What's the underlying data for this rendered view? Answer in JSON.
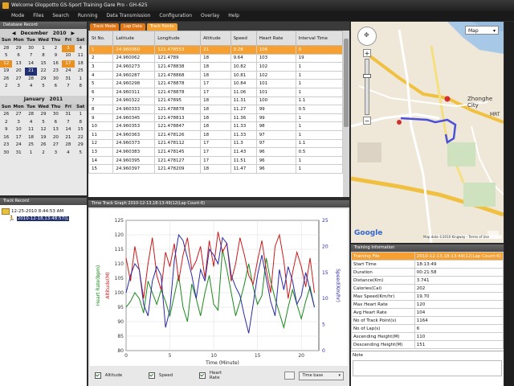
{
  "window": {
    "title": "Welcome Gloppotto GS-Sport Training Gare Pro - GH-625"
  },
  "menu": [
    "Mode",
    "Files",
    "Search",
    "Running",
    "Data Transmission",
    "Configuration",
    "Overlay",
    "Help"
  ],
  "database": {
    "title": "Database Record",
    "cal1": {
      "month": "December",
      "year": "2010",
      "dow": [
        "Sun",
        "Mon",
        "Tue",
        "Wed",
        "Thu",
        "Fri",
        "Sat"
      ],
      "days": [
        "28",
        "29",
        "30",
        "1",
        "2",
        "3",
        "4",
        "5",
        "6",
        "7",
        "8",
        "9",
        "10",
        "11",
        "12",
        "13",
        "14",
        "15",
        "16",
        "17",
        "18",
        "19",
        "20",
        "21",
        "22",
        "23",
        "24",
        "25",
        "26",
        "27",
        "28",
        "29",
        "30",
        "31",
        "1",
        "2",
        "3",
        "4",
        "5",
        "6",
        "7",
        "8"
      ]
    },
    "cal2": {
      "month": "January",
      "year": "2011",
      "dow": [
        "Sun",
        "Mon",
        "Tue",
        "Wed",
        "Thu",
        "Fri",
        "Sat"
      ],
      "days": [
        "26",
        "27",
        "28",
        "29",
        "30",
        "31",
        "1",
        "2",
        "3",
        "4",
        "5",
        "6",
        "7",
        "8",
        "9",
        "10",
        "11",
        "12",
        "13",
        "14",
        "15",
        "16",
        "17",
        "18",
        "19",
        "20",
        "21",
        "22",
        "23",
        "24",
        "25",
        "26",
        "27",
        "28",
        "29",
        "30",
        "31",
        "1",
        "2",
        "3",
        "4",
        "5"
      ]
    }
  },
  "track_record": {
    "title": "Track Record",
    "items": [
      "12-25-2010 8:44:53 AM",
      "2010-12-18,13:48:57(L"
    ]
  },
  "tabs": [
    "Track Mode",
    "Lap Data",
    "Track Points"
  ],
  "table": {
    "columns": [
      "St No.",
      "Latitude",
      "Longitude",
      "Altitude",
      "Speed",
      "Heart Rate",
      "Interval Time"
    ],
    "rows": [
      [
        "1",
        "24.960060",
        "121.478553",
        "21",
        "0.28",
        "106",
        "0"
      ],
      [
        "2",
        "24.960062",
        "121.4789",
        "18",
        "9.64",
        "103",
        "19"
      ],
      [
        "3",
        "24.960273",
        "121.478838",
        "18",
        "10.82",
        "102",
        "1"
      ],
      [
        "4",
        "24.960287",
        "121.478868",
        "18",
        "10.81",
        "102",
        "1"
      ],
      [
        "5",
        "24.960298",
        "121.478878",
        "17",
        "10.84",
        "101",
        "1"
      ],
      [
        "6",
        "24.960311",
        "121.478878",
        "17",
        "11.06",
        "101",
        "1"
      ],
      [
        "7",
        "24.960322",
        "121.47895",
        "18",
        "11.31",
        "100",
        "1.1"
      ],
      [
        "8",
        "24.960333",
        "121.478878",
        "18",
        "11.27",
        "99",
        "0.5"
      ],
      [
        "9",
        "24.960345",
        "121.478813",
        "18",
        "11.36",
        "99",
        "1"
      ],
      [
        "10",
        "24.960353",
        "121.478847",
        "18",
        "11.33",
        "98",
        "1"
      ],
      [
        "11",
        "24.960363",
        "121.478126",
        "18",
        "11.33",
        "97",
        "1"
      ],
      [
        "12",
        "24.960373",
        "121.478112",
        "17",
        "11.3",
        "97",
        "1.1"
      ],
      [
        "13",
        "24.960383",
        "121.478145",
        "17",
        "11.43",
        "96",
        "0.5"
      ],
      [
        "14",
        "24.960395",
        "121.478127",
        "17",
        "11.51",
        "96",
        "1"
      ],
      [
        "15",
        "24.960397",
        "121.478209",
        "18",
        "11.47",
        "96",
        "1"
      ]
    ]
  },
  "chart_panel": {
    "title": "Time Track Graph 2010-12-13,18:13:49(12(Lap Count:6)"
  },
  "chart_data": {
    "type": "line",
    "title": "",
    "xlabel": "Time (Minute)",
    "ylabel": "Heart Rate(bpm)",
    "y2label": "Speed(Km/hr)",
    "y3label": "Altitude(M)",
    "xlim": [
      0,
      22
    ],
    "ylim": [
      80,
      125
    ],
    "x_ticks": [
      "0",
      "5",
      "10",
      "15",
      "20"
    ],
    "y_ticks": [
      "80",
      "85",
      "90",
      "95",
      "100",
      "105",
      "110",
      "115",
      "120",
      "125"
    ],
    "y2_ticks": [
      "0",
      "5",
      "10",
      "15",
      "20",
      "25"
    ],
    "series": [
      {
        "name": "Altitude",
        "color": "#1a8a1a",
        "x": [
          0,
          0.5,
          1,
          1.5,
          2,
          2.5,
          3,
          3.5,
          4,
          4.5,
          5,
          5.5,
          6,
          6.5,
          7,
          7.5,
          8,
          8.5,
          9,
          9.5,
          10,
          10.5,
          11,
          11.5,
          12,
          12.5,
          13,
          13.5,
          14,
          14.5,
          15,
          15.5,
          16,
          16.5,
          17,
          17.5,
          18,
          18.5,
          19,
          19.5,
          20,
          20.5,
          21,
          21.5
        ],
        "y": [
          95,
          97,
          100,
          98,
          93,
          104,
          100,
          96,
          101,
          97,
          92,
          99,
          106,
          95,
          90,
          103,
          98,
          92,
          100,
          106,
          96,
          94,
          115,
          108,
          100,
          92,
          97,
          103,
          110,
          102,
          96,
          99,
          112,
          104,
          98,
          93,
          88,
          95,
          101,
          96,
          91,
          97,
          102,
          95
        ]
      },
      {
        "name": "Speed",
        "color": "#cc1a1a",
        "x": [
          0,
          0.5,
          1,
          1.5,
          2,
          2.5,
          3,
          3.5,
          4,
          4.5,
          5,
          5.5,
          6,
          6.5,
          7,
          7.5,
          8,
          8.5,
          9,
          9.5,
          10,
          10.5,
          11,
          11.5,
          12,
          12.5,
          13,
          13.5,
          14,
          14.5,
          15,
          15.5,
          16,
          16.5,
          17,
          17.5,
          18,
          18.5,
          19,
          19.5,
          20,
          20.5,
          21,
          21.5
        ],
        "y": [
          112,
          104,
          116,
          108,
          98,
          110,
          119,
          106,
          101,
          114,
          109,
          117,
          104,
          113,
          119,
          108,
          111,
          116,
          105,
          118,
          109,
          121,
          114,
          117,
          104,
          110,
          119,
          113,
          106,
          103,
          111,
          118,
          108,
          100,
          116,
          120,
          111,
          98,
          107,
          114,
          109,
          102,
          112,
          100
        ]
      },
      {
        "name": "Heart Rate",
        "color": "#2a2aa8",
        "x": [
          0,
          0.5,
          1,
          1.5,
          2,
          2.5,
          3,
          3.5,
          4,
          4.5,
          5,
          5.5,
          6,
          6.5,
          7,
          7.5,
          8,
          8.5,
          9,
          9.5,
          10,
          10.5,
          11,
          11.5,
          12,
          12.5,
          13,
          13.5,
          14,
          14.5,
          15,
          15.5,
          16,
          16.5,
          17,
          17.5,
          18,
          18.5,
          19,
          19.5,
          20,
          20.5,
          21,
          21.5
        ],
        "y": [
          100,
          106,
          110,
          108,
          96,
          92,
          104,
          109,
          106,
          88,
          94,
          111,
          120,
          118,
          112,
          106,
          98,
          108,
          104,
          115,
          113,
          110,
          119,
          117,
          106,
          102,
          99,
          92,
          86,
          96,
          106,
          113,
          105,
          97,
          92,
          108,
          101,
          109,
          104,
          96,
          99,
          107,
          101,
          95
        ]
      }
    ]
  },
  "chart_legend": {
    "altitude": "Altitude",
    "speed": "Speed",
    "heart_rate": "Heart Rate",
    "time_base": "Time base"
  },
  "map": {
    "maptype": "Map",
    "place1": "Zhonghe City",
    "place2": "MRT",
    "footer": "Map data ©2010 Kingway - Terms of Use",
    "google": "Google"
  },
  "training_info": {
    "title": "Training Information",
    "rows": [
      [
        "Training File",
        "2010-12-13,18:13:49(12(Lap Count:6)"
      ],
      [
        "Start Time",
        "18:13:49"
      ],
      [
        "Duration",
        "00:21:58"
      ],
      [
        "Distance(Km)",
        "3.741"
      ],
      [
        "Calories(Cal)",
        "202"
      ],
      [
        "Max Speed(Km/hr)",
        "19.70"
      ],
      [
        "Max Heart Rate",
        "120"
      ],
      [
        "Avg Heart Rate",
        "104"
      ],
      [
        "No of Track Point(s)",
        "1164"
      ],
      [
        "No of Lap(s)",
        "6"
      ],
      [
        "Ascending Height(M)",
        "110"
      ],
      [
        "Descending Height(M)",
        "151"
      ]
    ],
    "note_label": "Note"
  },
  "colors": {
    "accent": "#f5a030",
    "selection": "#203070",
    "panel_bg": "#2b2b2b"
  }
}
